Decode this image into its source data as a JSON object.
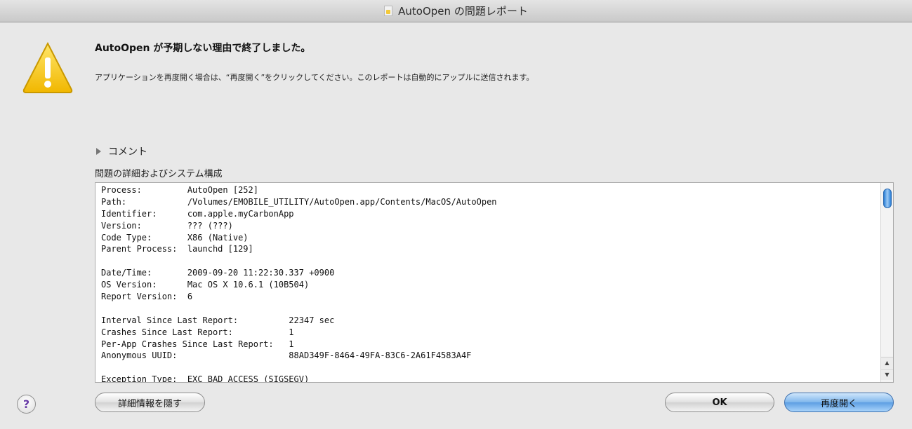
{
  "window": {
    "title": "AutoOpen の問題レポート"
  },
  "alert": {
    "headline": "AutoOpen が予期しない理由で終了しました。",
    "message": "アプリケーションを再度開く場合は、“再度開く”をクリックしてください。このレポートは自動的にアップルに送信されます。",
    "icon": "warning-triangle-icon",
    "icon_color": "#f5c623"
  },
  "comments": {
    "label": "コメント"
  },
  "details": {
    "label": "問題の詳細およびシステム構成",
    "lines": [
      "Process:         AutoOpen [252]",
      "Path:            /Volumes/EMOBILE_UTILITY/AutoOpen.app/Contents/MacOS/AutoOpen",
      "Identifier:      com.apple.myCarbonApp",
      "Version:         ??? (???)",
      "Code Type:       X86 (Native)",
      "Parent Process:  launchd [129]",
      "",
      "Date/Time:       2009-09-20 11:22:30.337 +0900",
      "OS Version:      Mac OS X 10.6.1 (10B504)",
      "Report Version:  6",
      "",
      "Interval Since Last Report:          22347 sec",
      "Crashes Since Last Report:           1",
      "Per-App Crashes Since Last Report:   1",
      "Anonymous UUID:                      88AD349F-8464-49FA-83C6-2A61F4583A4F",
      "",
      "Exception Type:  EXC_BAD_ACCESS (SIGSEGV)"
    ]
  },
  "buttons": {
    "help": "?",
    "hide_details": "詳細情報を隠す",
    "ok": "OK",
    "reopen": "再度開く"
  }
}
